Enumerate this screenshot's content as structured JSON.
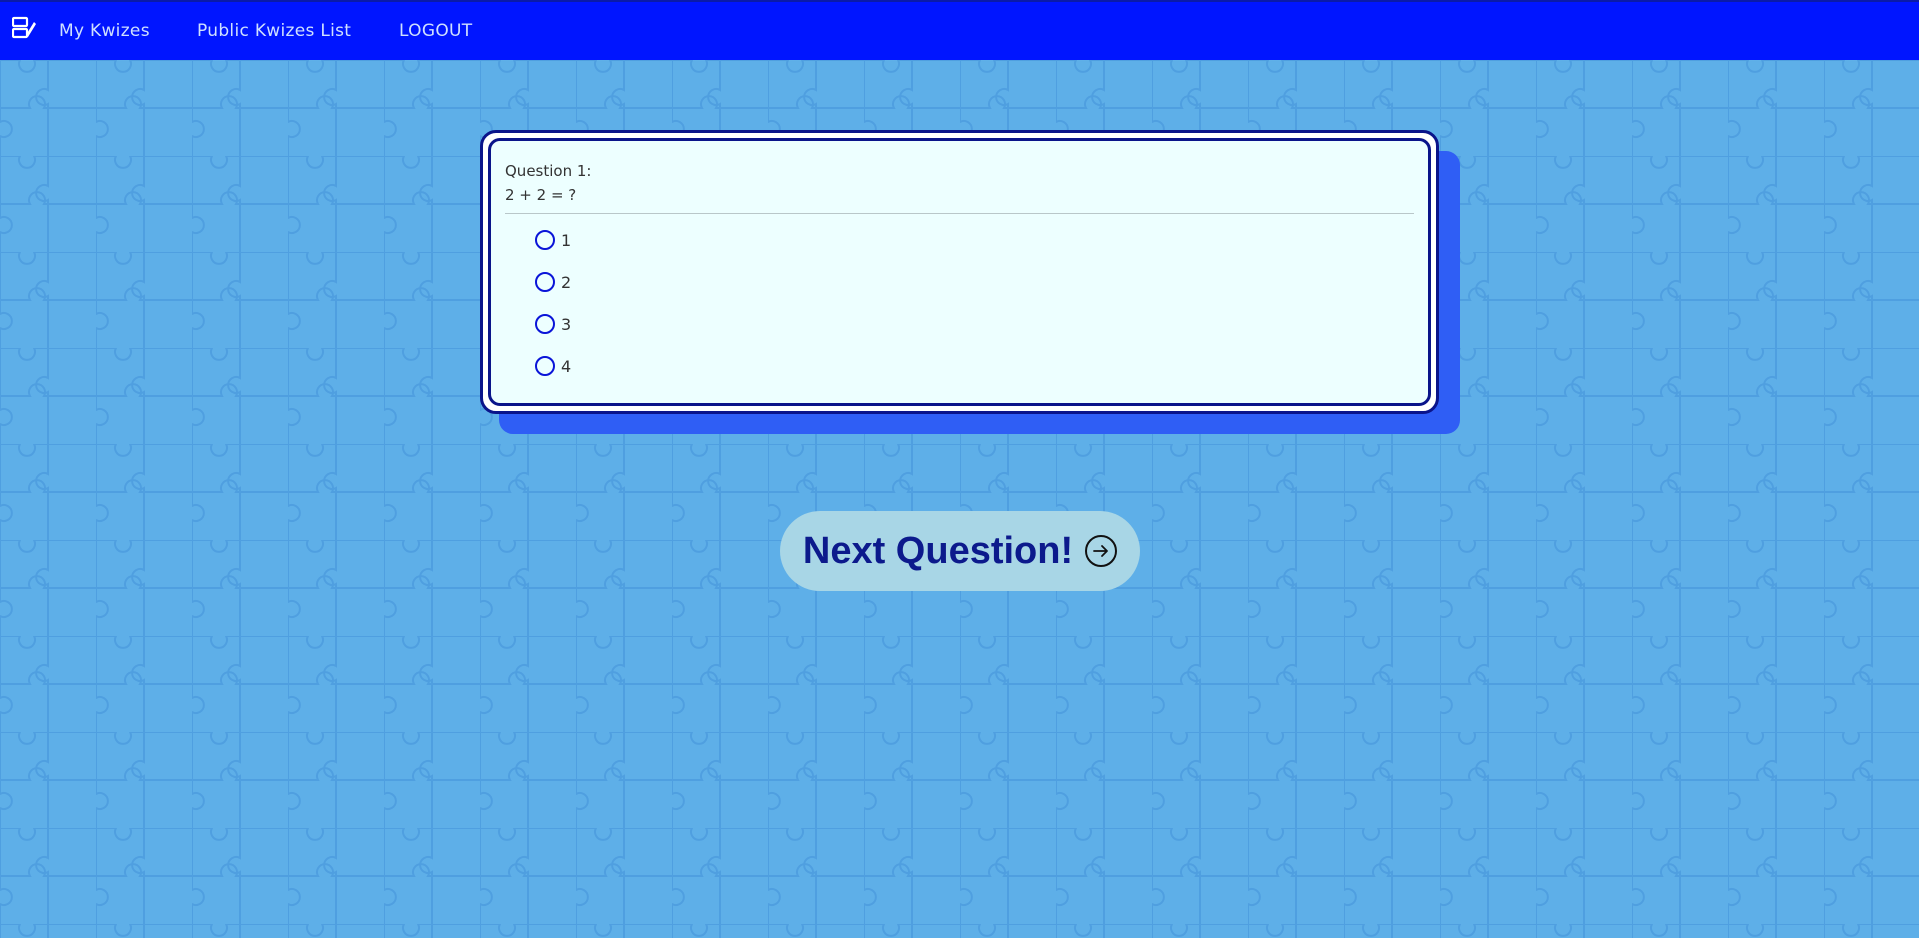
{
  "nav": {
    "brand_icon": "quiz-editor-icon",
    "links": [
      {
        "label": "My Kwizes"
      },
      {
        "label": "Public Kwizes List"
      },
      {
        "label": "LOGOUT"
      }
    ]
  },
  "question": {
    "title": "Question 1:",
    "text": "2 + 2 = ?",
    "options": [
      {
        "label": "1",
        "selected": false
      },
      {
        "label": "2",
        "selected": false
      },
      {
        "label": "3",
        "selected": false
      },
      {
        "label": "4",
        "selected": false
      }
    ]
  },
  "next_button": {
    "label": "Next Question!",
    "icon": "arrow-right-circle-icon"
  },
  "colors": {
    "navbar": "#0015ff",
    "background": "#5eafe8",
    "card_shadow": "#2f5ef5",
    "card_border": "#0a148a",
    "card_fill": "#edffff",
    "radio": "#0a14d8",
    "button_fill": "#a8d6e6",
    "button_text": "#0c1a8c"
  }
}
